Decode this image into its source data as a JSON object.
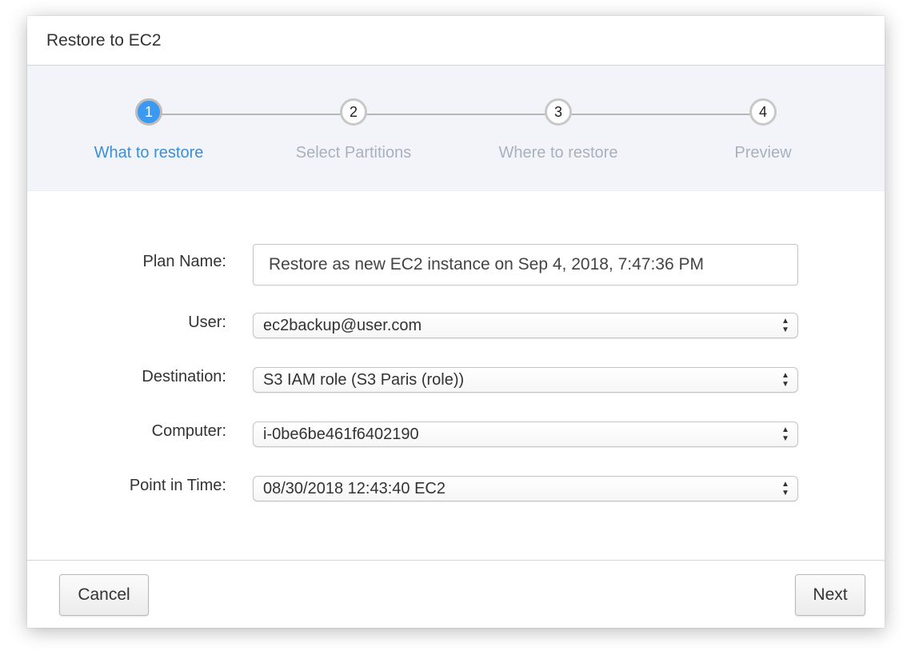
{
  "dialog": {
    "title": "Restore to EC2"
  },
  "wizard": {
    "steps": [
      {
        "number": "1",
        "label": "What to restore",
        "active": true
      },
      {
        "number": "2",
        "label": "Select Partitions",
        "active": false
      },
      {
        "number": "3",
        "label": "Where to restore",
        "active": false
      },
      {
        "number": "4",
        "label": "Preview",
        "active": false
      }
    ]
  },
  "form": {
    "plan_name": {
      "label": "Plan Name:",
      "value": "Restore as new EC2 instance on Sep 4, 2018, 7:47:36 PM"
    },
    "user": {
      "label": "User:",
      "value": "ec2backup@user.com"
    },
    "destination": {
      "label": "Destination:",
      "value": "S3 IAM role (S3 Paris (role))"
    },
    "computer": {
      "label": "Computer:",
      "value": "i-0be6be461f6402190"
    },
    "point_in_time": {
      "label": "Point in Time:",
      "value": "08/30/2018 12:43:40 EC2"
    }
  },
  "footer": {
    "cancel_label": "Cancel",
    "next_label": "Next"
  },
  "colors": {
    "accent": "#3b99f0",
    "active_label": "#3a8fd8",
    "inactive_label": "#a9b1bb",
    "wizard_background": "#f3f4f9"
  },
  "icons": {
    "select_arrows": "updown-arrows-icon"
  }
}
